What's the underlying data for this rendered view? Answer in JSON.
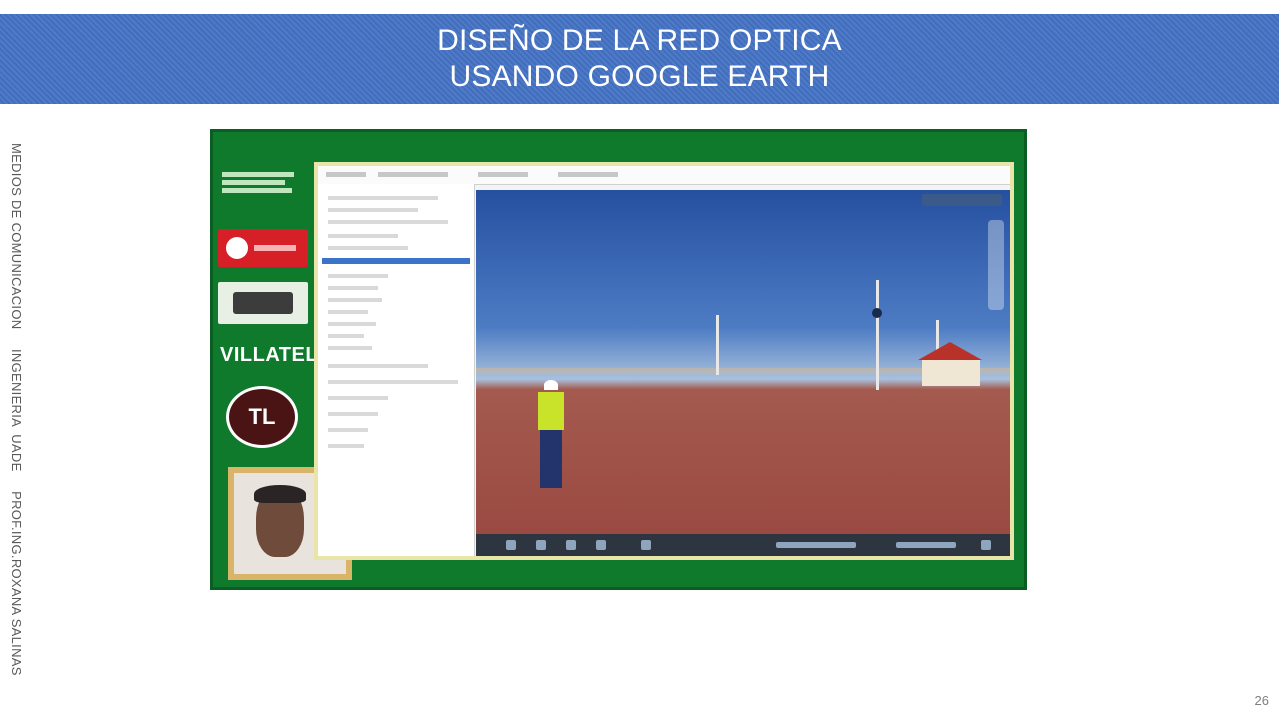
{
  "header": {
    "title_line1": "DISEÑO DE LA RED OPTICA",
    "title_line2": "USANDO GOOGLE EARTH"
  },
  "sidebar_caption": "MEDIOS DE COMUNICACION     INGENIERIA  UADE     PROF.ING.ROXANA SALINAS",
  "page_number": "26",
  "video": {
    "logo_text": "VILLATEL",
    "badge_text": "TL"
  },
  "colors": {
    "title_bar": "#4472c4",
    "video_background": "#0f7a2c"
  }
}
